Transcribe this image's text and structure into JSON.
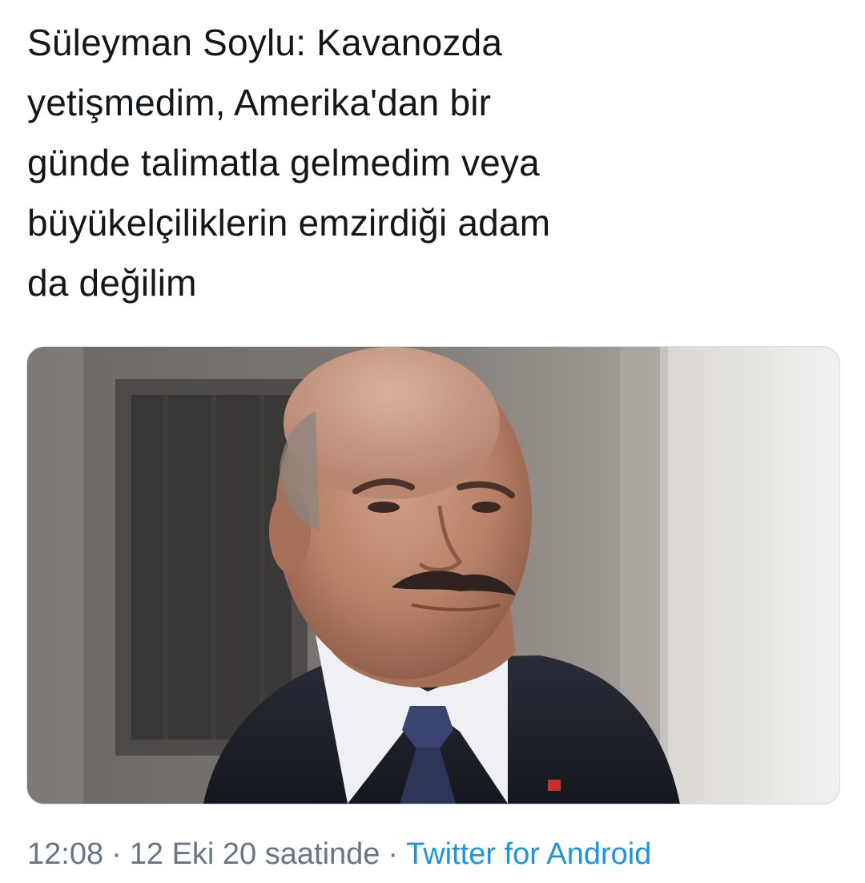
{
  "tweet": {
    "text": "Süleyman Soylu: Kavanozda\nyetişmedim, Amerika'dan bir\ngünde talimatla gelmedim veya\nbüyükelçiliklerin emzirdiği adam\nda değilim"
  },
  "media": {
    "icon": "photo-of-man-in-suit"
  },
  "meta": {
    "time": "12:08",
    "separator": "·",
    "date": "12 Eki 20 saatinde",
    "source": "Twitter for Android"
  },
  "colors": {
    "text": "#14171a",
    "meta": "#657786",
    "link": "#1b95e0",
    "border": "#d6dde3"
  }
}
